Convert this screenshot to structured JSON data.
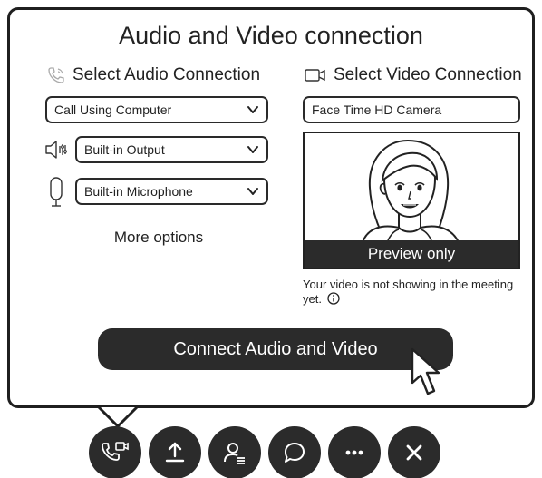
{
  "dialog": {
    "title": "Audio and Video connection",
    "audio": {
      "heading": "Select Audio Connection",
      "connection_value": "Call Using Computer",
      "output_value": "Built-in Output",
      "microphone_value": "Built-in Microphone",
      "more_options": "More options"
    },
    "video": {
      "heading": "Select Video Connection",
      "camera_value": "Face Time HD Camera",
      "preview_label": "Preview only",
      "notice": "Your video is not showing in the meeting yet."
    },
    "connect_button": "Connect Audio and Video"
  },
  "toolbar": {
    "buttons": [
      "audio-video-icon",
      "share-icon",
      "participants-icon",
      "chat-icon",
      "more-icon",
      "close-icon"
    ]
  },
  "colors": {
    "dark": "#2b2b2b",
    "border": "#1f1f1f",
    "background": "#ffffff"
  }
}
